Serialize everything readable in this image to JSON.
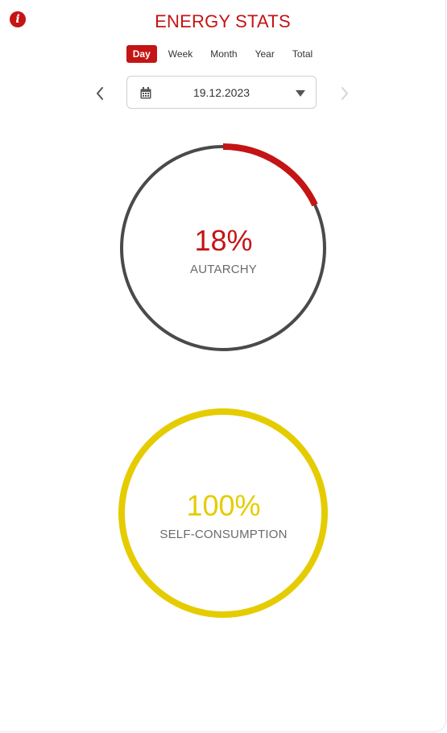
{
  "header": {
    "title": "ENERGY STATS",
    "info_icon": "info-icon"
  },
  "tabs": [
    {
      "label": "Day",
      "active": true
    },
    {
      "label": "Week",
      "active": false
    },
    {
      "label": "Month",
      "active": false
    },
    {
      "label": "Year",
      "active": false
    },
    {
      "label": "Total",
      "active": false
    }
  ],
  "date_picker": {
    "value": "19.12.2023",
    "calendar_icon": "calendar-icon",
    "dropdown_icon": "caret-down-icon",
    "prev_icon": "chevron-left-icon",
    "next_icon": "chevron-right-icon",
    "next_disabled": true
  },
  "stats": {
    "autarchy": {
      "value_text": "18%",
      "percent": 18,
      "label": "AUTARCHY",
      "color": "#c41414",
      "track_color": "#4a4a4a"
    },
    "self_consumption": {
      "value_text": "100%",
      "percent": 100,
      "label": "SELF-CONSUMPTION",
      "color": "#e5cc00",
      "track_color": "#4a4a4a"
    }
  },
  "colors": {
    "accent": "#c41414",
    "text": "#333333",
    "muted": "#6b6b6b"
  }
}
